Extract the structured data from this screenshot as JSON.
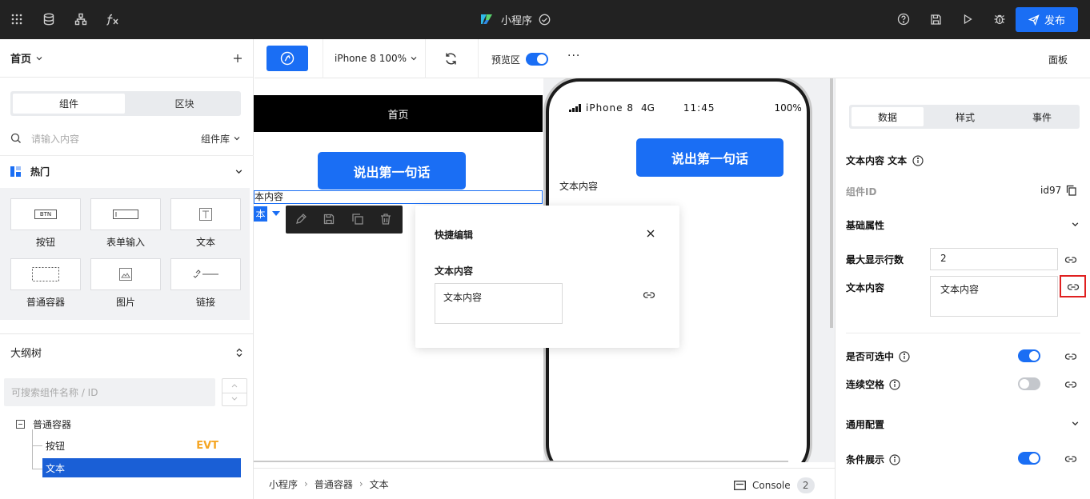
{
  "topbar": {
    "app_title": "小程序",
    "publish_label": "发布",
    "icons": [
      "apps-grid-icon",
      "database-icon",
      "tree-icon",
      "function-icon",
      "help-icon",
      "save-icon",
      "play-icon",
      "debug-icon",
      "send-icon"
    ]
  },
  "left": {
    "page_selector": "首页",
    "tabs": [
      "组件",
      "区块"
    ],
    "search_placeholder": "请输入内容",
    "library_label": "组件库",
    "section_title": "热门",
    "components": [
      {
        "label": "按钮",
        "preview": "BTN"
      },
      {
        "label": "表单输入"
      },
      {
        "label": "文本"
      },
      {
        "label": "普通容器"
      },
      {
        "label": "图片"
      },
      {
        "label": "链接"
      }
    ],
    "outline_title": "大纲树",
    "outline_search_placeholder": "可搜索组件名称 / ID",
    "tree": {
      "root": "普通容器",
      "children": [
        {
          "label": "按钮",
          "badge": "EVT"
        },
        {
          "label": "文本",
          "selected": true
        }
      ]
    }
  },
  "canvas_toolbar": {
    "device": "iPhone 8 100%",
    "preview_label": "预览区",
    "preview_on": true,
    "more": "···"
  },
  "canvas": {
    "page_header": "首页",
    "button_label": "说出第一句话",
    "text_content": "本内容",
    "selected_tag": "本",
    "phone": {
      "carrier": "iPhone 8",
      "network": "4G",
      "time": "11:45",
      "battery": "100%",
      "button_label": "说出第一句话",
      "text": "文本内容"
    },
    "quick_edit": {
      "title": "快捷编辑",
      "field_label": "文本内容",
      "field_value": "文本内容"
    }
  },
  "breadcrumb": [
    "小程序",
    "普通容器",
    "文本"
  ],
  "console": {
    "label": "Console",
    "count": "2"
  },
  "right": {
    "panel_label": "面板",
    "tabs": [
      "数据",
      "样式",
      "事件"
    ],
    "component_title": "文本内容 文本",
    "component_id_label": "组件ID",
    "component_id": "id97",
    "basic_props": "基础属性",
    "max_lines_label": "最大显示行数",
    "max_lines_value": "2",
    "text_content_label": "文本内容",
    "text_content_value": "文本内容",
    "selectable_label": "是否可选中",
    "selectable_on": true,
    "continuous_space_label": "连续空格",
    "continuous_space_on": false,
    "general_config": "通用配置",
    "condition_label": "条件展示",
    "condition_on": true
  },
  "colors": {
    "accent": "#1a6ef4",
    "topbar": "#222222",
    "highlight": "#e02020",
    "badge": "#f5a623"
  }
}
